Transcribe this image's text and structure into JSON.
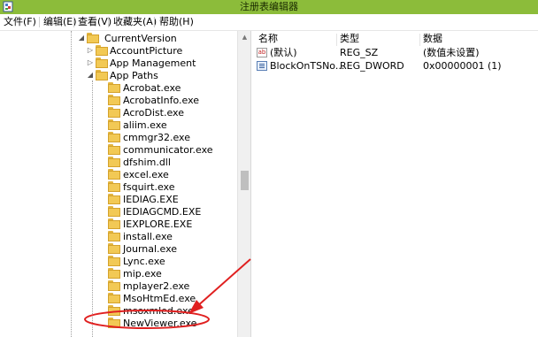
{
  "window": {
    "title": "注册表编辑器",
    "title_bar_color": "#8cbc3a"
  },
  "menu": [
    {
      "label": "文件(F)"
    },
    {
      "label": "编辑(E)"
    },
    {
      "label": "查看(V)"
    },
    {
      "label": "收藏夹(A)"
    },
    {
      "label": "帮助(H)"
    }
  ],
  "tree": {
    "parent": {
      "label": "CurrentVersion",
      "expanded": true
    },
    "siblings": [
      {
        "label": "AccountPicture",
        "expander": "collapsed"
      },
      {
        "label": "App Management",
        "expander": "collapsed"
      },
      {
        "label": "App Paths",
        "expander": "expanded"
      }
    ],
    "app_paths_children": [
      "Acrobat.exe",
      "AcrobatInfo.exe",
      "AcroDist.exe",
      "aliim.exe",
      "cmmgr32.exe",
      "communicator.exe",
      "dfshim.dll",
      "excel.exe",
      "fsquirt.exe",
      "IEDIAG.EXE",
      "IEDIAGCMD.EXE",
      "IEXPLORE.EXE",
      "install.exe",
      "Journal.exe",
      "Lync.exe",
      "mip.exe",
      "mplayer2.exe",
      "MsoHtmEd.exe",
      "msoxmled.exe",
      "NewViewer.exe"
    ],
    "highlighted_key": "NewViewer.exe"
  },
  "list": {
    "columns": {
      "name": "名称",
      "type": "类型",
      "data": "数据"
    },
    "rows": [
      {
        "icon": "string-value-icon",
        "name": "(默认)",
        "type": "REG_SZ",
        "data": "(数值未设置)"
      },
      {
        "icon": "binary-value-icon",
        "name": "BlockOnTSNo...",
        "type": "REG_DWORD",
        "data": "0x00000001 (1)"
      }
    ]
  },
  "annotation": {
    "color": "#e02020",
    "shape": "ellipse-with-arrow",
    "target": "NewViewer.exe"
  }
}
